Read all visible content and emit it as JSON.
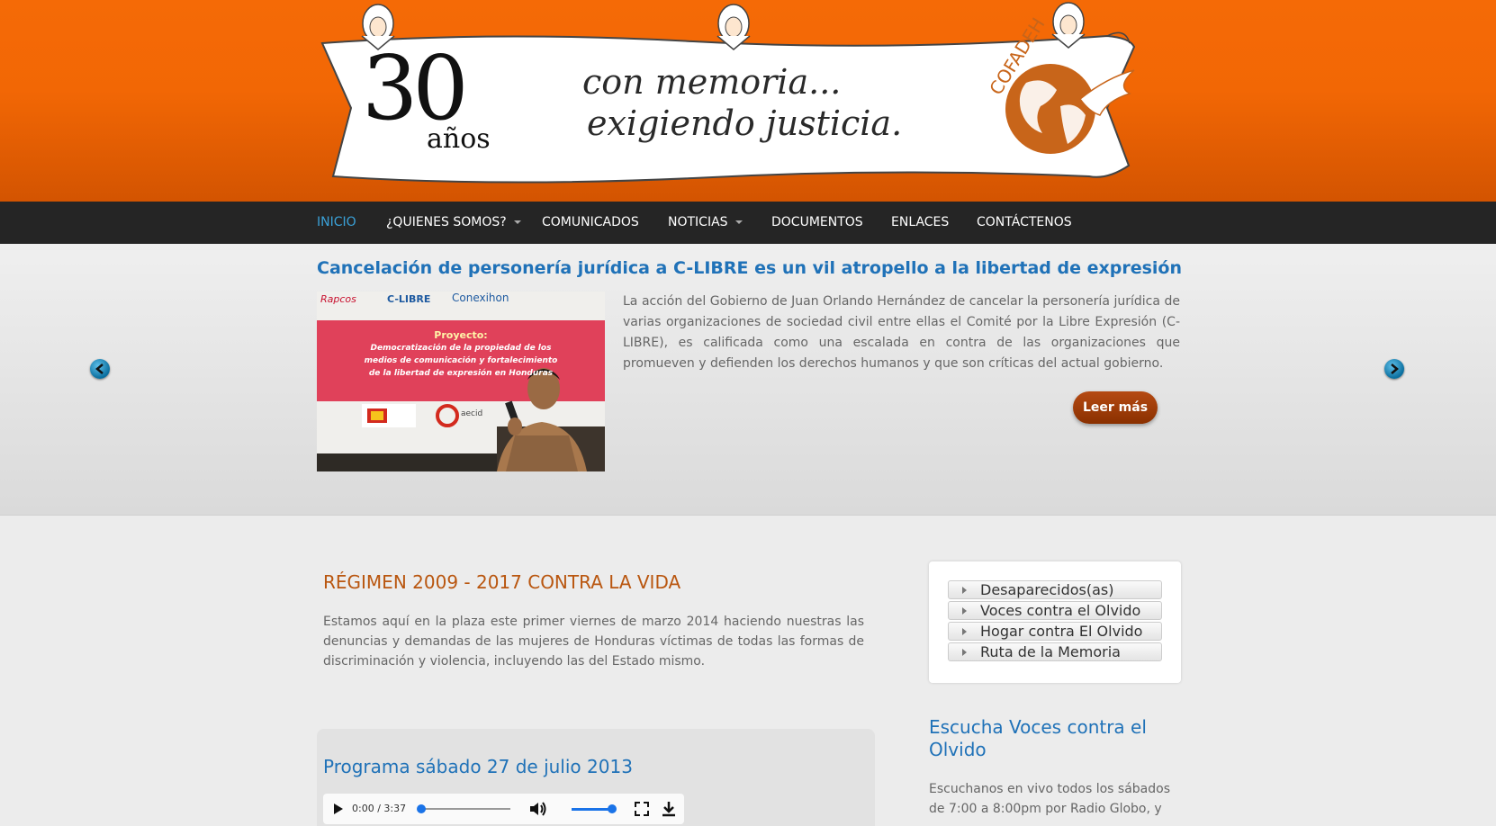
{
  "banner": {
    "number": "30",
    "years": "años",
    "slogan_line1": "con memoria...",
    "slogan_line2": "exigiendo justicia.",
    "org": "COFADEH"
  },
  "nav": {
    "items": [
      {
        "label": "INICIO",
        "active": true
      },
      {
        "label": "¿QUIENES SOMOS?",
        "dropdown": true
      },
      {
        "label": "COMUNICADOS"
      },
      {
        "label": "NOTICIAS",
        "dropdown": true
      },
      {
        "label": "DOCUMENTOS"
      },
      {
        "label": "ENLACES"
      },
      {
        "label": "CONTÁCTENOS"
      }
    ]
  },
  "slider": {
    "title": "Cancelación de personería jurídica a C-LIBRE es un vil atropello a la libertad de expresión",
    "text": "La acción del Gobierno de Juan Orlando Hernández de cancelar la personería jurídica de varias organizaciones de sociedad civil entre ellas el Comité por la Libre Expresión (C-LIBRE), es calificada como una escalada en contra de las organizaciones que promueven y defienden los  derechos humanos y que son críticas del actual gobierno.",
    "read_more": "Leer más",
    "image": {
      "logo1": "Rapcos",
      "logo2": "C-LIBRE",
      "logo3": "Conexihon",
      "heading": "Proyecto:",
      "line1": "Democratización de la propiedad de los",
      "line2": "medios de comunicación y fortalecimiento",
      "line3": "de la libertad de expresión en Honduras",
      "sponsor": "aecid"
    }
  },
  "main": {
    "title": "RÉGIMEN 2009 - 2017 CONTRA LA VIDA",
    "text": "Estamos aquí en la plaza este primer viernes de marzo 2014 haciendo nuestras las denuncias y demandas de las mujeres de Honduras víctimas de todas las formas de discriminación y violencia, incluyendo las del Estado mismo.",
    "program_title": "Programa sábado 27 de julio 2013",
    "audio_time": "0:00 / 3:37"
  },
  "sidebar": {
    "menu": [
      "Desaparecidos(as)",
      "Voces contra el Olvido",
      "Hogar contra El Olvido",
      "Ruta de la Memoria"
    ],
    "listen_title": "Escucha Voces contra el Olvido",
    "listen_text": "Escuchanos en vivo todos los sábados de 7:00 a 8:00pm por Radio Globo, y"
  },
  "colors": {
    "header_orange": "#f26705",
    "nav_bg": "#252525",
    "link_blue": "#2072b8",
    "title_brown": "#b9560f",
    "button_brown": "#9c3d07"
  }
}
